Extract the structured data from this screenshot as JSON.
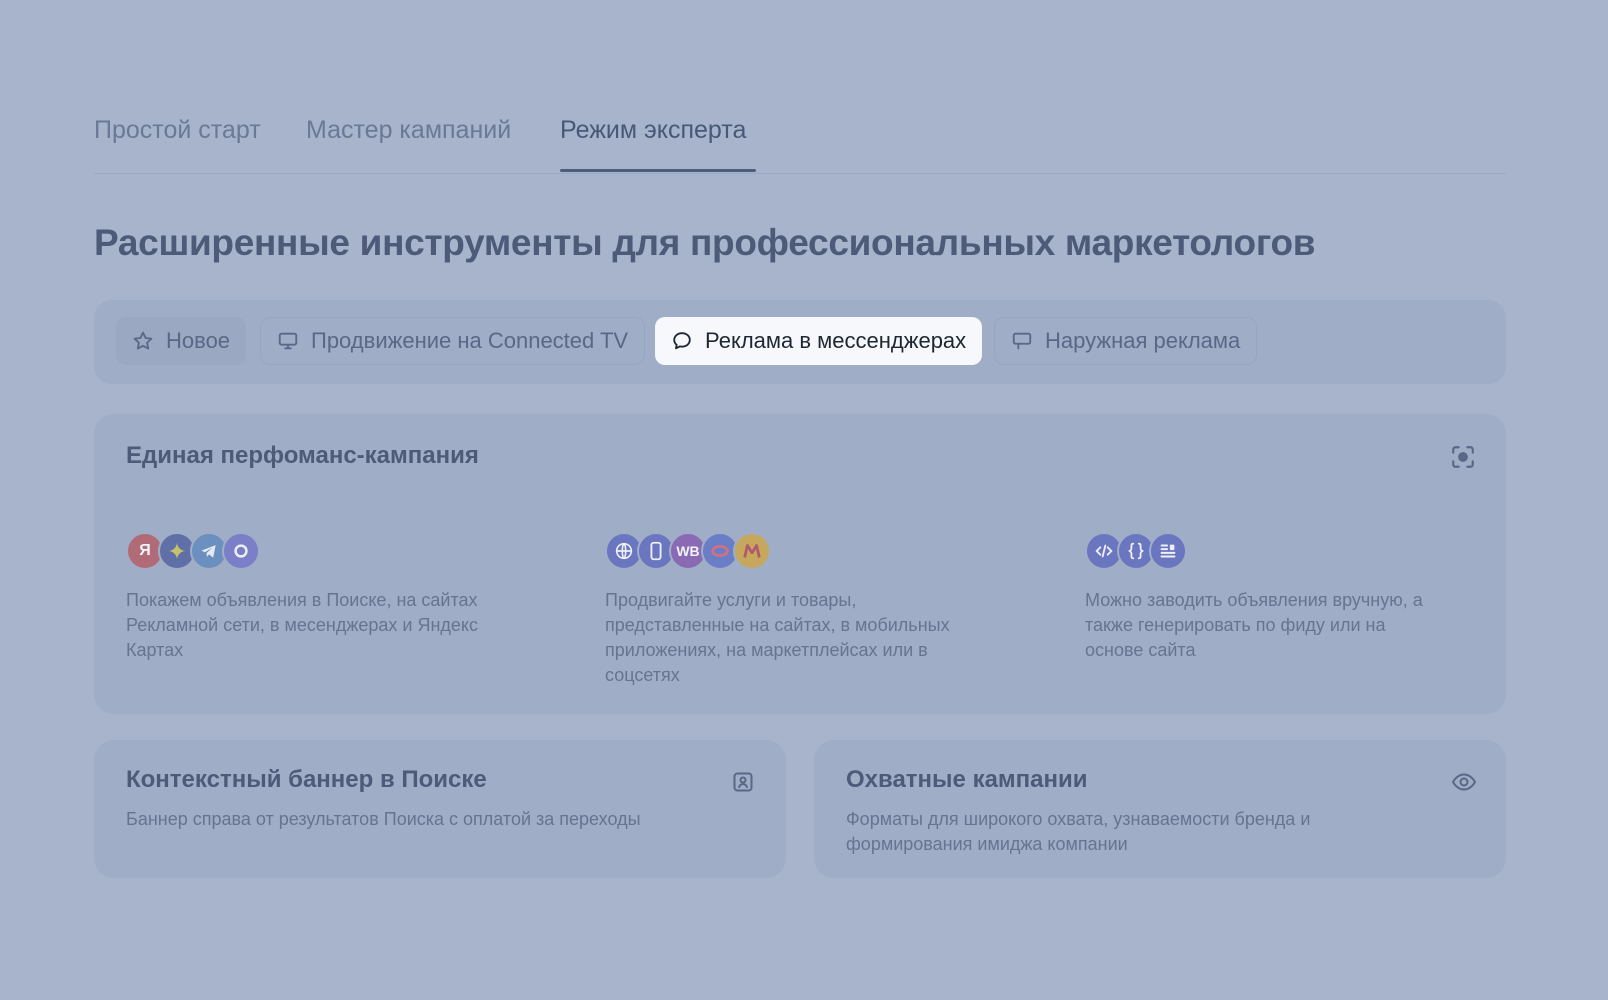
{
  "tabs": [
    {
      "label": "Простой старт",
      "active": false
    },
    {
      "label": "Мастер кампаний",
      "active": false
    },
    {
      "label": "Режим эксперта",
      "active": true
    }
  ],
  "headline": "Расширенные инструменты для профессиональных маркетологов",
  "chips": [
    {
      "label": "Новое",
      "icon": "star-icon",
      "selected": false
    },
    {
      "label": "Продвижение на Connected TV",
      "icon": "monitor-icon",
      "selected": false
    },
    {
      "label": "Реклама в мессенджерах",
      "icon": "chat-bubble-icon",
      "selected": true
    },
    {
      "label": "Наружная реклама",
      "icon": "billboard-icon",
      "selected": false
    }
  ],
  "performance_card": {
    "title": "Единая перфоманс-кампания",
    "corner_icon": "target-icon",
    "features": [
      {
        "icons": [
          "yandex-icon",
          "zen-icon",
          "telegram-icon",
          "max-icon"
        ],
        "text": "Покажем объявления в Поиске, на сайтах Рекламной сети, в месенджерах и Яндекс Картах"
      },
      {
        "icons": [
          "globe-icon",
          "mobile-icon",
          "wb-icon",
          "ozon-icon",
          "market-icon"
        ],
        "icon_labels": {
          "wb": "WB"
        },
        "text": "Продвигайте услуги и товары, представленные на сайтах, в мобильных приложениях, на маркетплейсах или в соцсетях"
      },
      {
        "icons": [
          "code-icon",
          "braces-icon",
          "feed-icon"
        ],
        "text": "Можно заводить объявления вручную, а также генерировать по фиду или на основе сайта"
      }
    ]
  },
  "banner_card": {
    "title": "Контекстный баннер в Поиске",
    "desc": "Баннер справа от результатов Поиска с оплатой за переходы",
    "corner_icon": "image-icon"
  },
  "reach_card": {
    "title": "Охватные кампании",
    "desc": "Форматы для широкого охвата, узнаваемости бренда и формирования имиджа компании",
    "corner_icon": "eye-icon"
  },
  "colors": {
    "background": "#a7b4cb",
    "card": "#a0adc6",
    "selected_chip": "#f7f8fb",
    "text_dark": "#4d5a78",
    "text_muted": "#67748f"
  }
}
